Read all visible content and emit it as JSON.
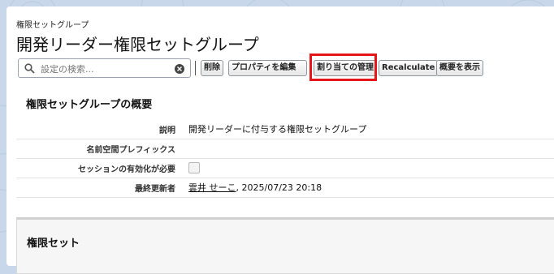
{
  "header": {
    "subtitle": "権限セットグループ",
    "title": "開発リーダー権限セットグループ"
  },
  "search": {
    "placeholder": "設定の検索..."
  },
  "buttons": {
    "delete": "削除",
    "edit_properties": "プロパティを編集",
    "manage_assignments": "割り当ての管理",
    "recalculate": "Recalculate",
    "view_summary": "概要を表示"
  },
  "details": {
    "section_title": "権限セットグループの概要",
    "description_label": "説明",
    "description_value": "開発リーダーに付与する権限セットグループ",
    "namespace_label": "名前空間プレフィックス",
    "namespace_value": "",
    "session_label": "セッションの有効化が必要",
    "session_required": false,
    "modified_label": "最終更新者",
    "modified_user": "雲井 せーこ",
    "modified_date": ", 2025/07/23 20:18"
  },
  "permission_sets": {
    "title": "権限セット"
  },
  "colors": {
    "highlight": "#e4161a",
    "background": "#c8d8ea"
  }
}
